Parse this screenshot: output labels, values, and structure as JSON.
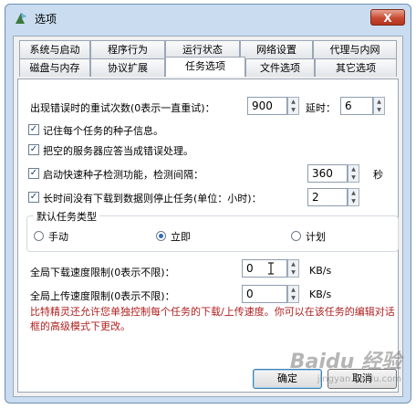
{
  "window": {
    "title": "选项",
    "close_label": "X"
  },
  "tabs_row1": [
    "系统与启动",
    "程序行为",
    "运行状态",
    "网络设置",
    "代理与内网"
  ],
  "tabs_row2": [
    "磁盘与内存",
    "协议扩展",
    "任务选项",
    "文件选项",
    "其它选项"
  ],
  "active_tab": "任务选项",
  "options": {
    "retry_label": "出现错误时的重试次数(0表示一直重试)：",
    "retry_value": "900",
    "delay_label": "延时：",
    "delay_value": "6",
    "remember_seed_label": "记住每个任务的种子信息。",
    "remember_seed_checked": true,
    "empty_server_label": "把空的服务器应答当成错误处理。",
    "empty_server_checked": true,
    "fast_seed_label": "启动快速种子检测功能，检测间隔：",
    "fast_seed_checked": true,
    "fast_seed_value": "360",
    "fast_seed_unit": "秒",
    "stop_task_label": "长时间没有下载到数据则停止任务(单位：小时)：",
    "stop_task_checked": true,
    "stop_task_value": "2"
  },
  "task_type": {
    "title": "默认任务类型",
    "options": [
      "手动",
      "立即",
      "计划"
    ],
    "selected": "立即"
  },
  "speed": {
    "download_label": "全局下载速度限制(0表示不限)：",
    "download_value": "0",
    "download_unit": "KB/s",
    "upload_label": "全局上传速度限制(0表示不限)：",
    "upload_value": "0",
    "upload_unit": "KB/s"
  },
  "note": "比特精灵还允许您单独控制每个任务的下载/上传速度。你可以在该任务的编辑对话框的高级模式下更改。",
  "buttons": {
    "ok": "确定",
    "cancel": "取消"
  },
  "watermark": {
    "main": "Baidu 经验",
    "sub": "jingyan.baidu.com"
  }
}
